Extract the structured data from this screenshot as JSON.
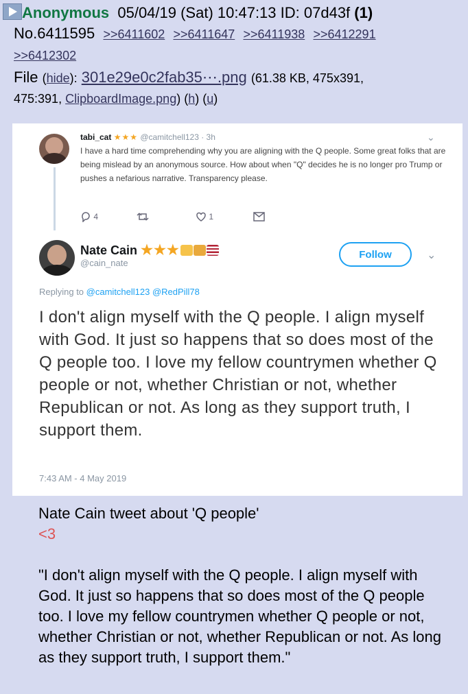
{
  "post": {
    "name": "Anonymous",
    "date": "05/04/19 (Sat) 10:47:13",
    "id_label": "ID: 07d43f",
    "id_count": "(1)",
    "number": "No.6411595",
    "replies": [
      ">>6411602",
      ">>6411647",
      ">>6411938",
      ">>6412291",
      ">>6412302"
    ],
    "file_label": "File",
    "hide": "hide",
    "file_name": "301e29e0c2fab35⋯.png",
    "file_meta_1": "(61.38 KB, 475x391,",
    "file_meta_2": "475:391,",
    "clip_name": "ClipboardImage.png",
    "h": "h",
    "u": "u"
  },
  "tweet1": {
    "username": "tabi_cat",
    "stars": "★★★",
    "handle_time": "@camitchell123 · 3h",
    "text": "I have a hard time comprehending why you are aligning with the Q people. Some great folks that are being mislead by an anonymous source.  How about when \"Q\" decides he is no longer pro Trump or pushes a nefarious narrative. Transparency please.",
    "reply_count": "4",
    "like_count": "1"
  },
  "tweet2": {
    "name": "Nate Cain",
    "stars": "★★★",
    "handle": "@cain_nate",
    "follow_label": "Follow",
    "replying_prefix": "Replying to",
    "replying_handles": "@camitchell123 @RedPill78",
    "text": "I don't align myself with the Q people. I align myself with God. It just so happens that so does most of the Q people too. I love my fellow countrymen whether Q people or not, whether Christian or not, whether Republican or not. As long as they support truth, I support them.",
    "date": "7:43 AM - 4 May 2019"
  },
  "comment": {
    "title": "Nate Cain tweet about 'Q people'",
    "heart": "<3",
    "quote": "\"I don't align myself with the Q people. I align myself with God. It just so happens that so does most of the Q people too. I love my fellow countrymen whether Q people or not, whether Christian or not, whether Republican or not. As long as they support truth, I support them.\""
  },
  "colors": {
    "background": "#d6daf0",
    "name": "#117743",
    "link": "#34345c",
    "twitter_blue": "#1da1f2",
    "heart": "#dd5555"
  }
}
